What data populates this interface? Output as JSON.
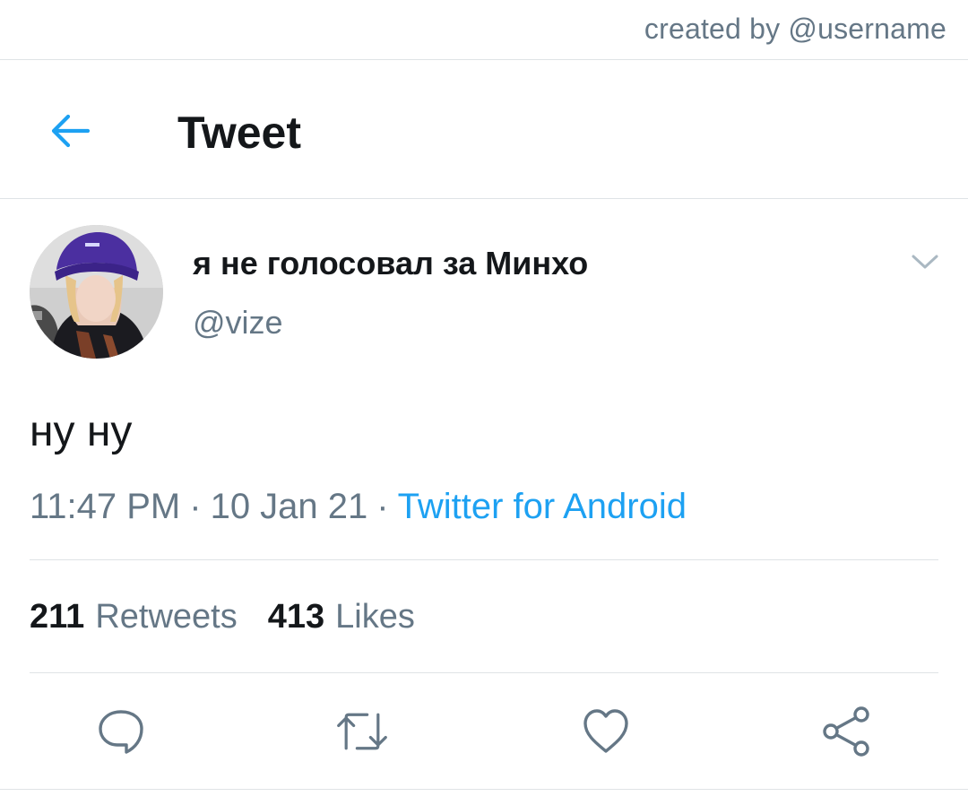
{
  "credit": {
    "text": "created by @username"
  },
  "header": {
    "title": "Tweet",
    "back_icon": "back-arrow-icon",
    "accent_color": "#1da1f2"
  },
  "tweet": {
    "display_name": "я не голосовал за Минхо",
    "handle": "@vize",
    "text": "ну ну",
    "time": "11:47 PM",
    "date": "10 Jan 21",
    "separator": "·",
    "source": "Twitter for Android",
    "stats": {
      "retweets_count": "211",
      "retweets_label": "Retweets",
      "likes_count": "413",
      "likes_label": "Likes"
    },
    "actions": [
      {
        "name": "reply",
        "icon": "reply-icon"
      },
      {
        "name": "retweet",
        "icon": "retweet-icon"
      },
      {
        "name": "like",
        "icon": "heart-icon"
      },
      {
        "name": "share",
        "icon": "share-icon"
      }
    ]
  },
  "colors": {
    "text_primary": "#14171a",
    "text_secondary": "#657786",
    "link": "#1da1f2",
    "divider": "#dfe3e6"
  }
}
